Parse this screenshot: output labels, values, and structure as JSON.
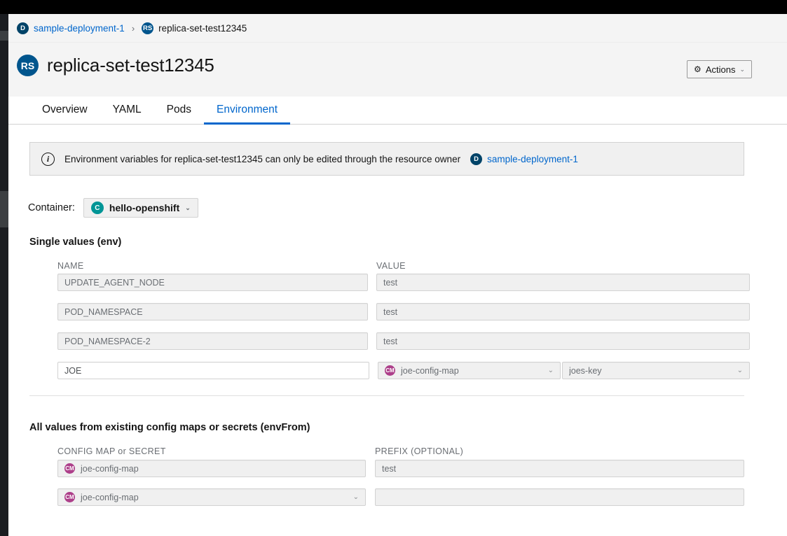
{
  "breadcrumb": {
    "items": [
      {
        "badge": "D",
        "badge_name": "deployment-badge-icon",
        "label": "sample-deployment-1",
        "link": true
      },
      {
        "badge": "RS",
        "badge_name": "replicaset-badge-icon",
        "label": "replica-set-test12345",
        "link": false
      }
    ],
    "separator": "›"
  },
  "header": {
    "badge": "RS",
    "title": "replica-set-test12345",
    "actions_label": "Actions",
    "actions_gear": "⚙",
    "actions_chevron": "⌄"
  },
  "tabs": [
    {
      "label": "Overview",
      "active": false
    },
    {
      "label": "YAML",
      "active": false
    },
    {
      "label": "Pods",
      "active": false
    },
    {
      "label": "Environment",
      "active": true
    }
  ],
  "alert": {
    "icon": "i",
    "message": "Environment variables for replica-set-test12345 can only be edited through the resource owner",
    "owner_badge": "D",
    "owner_label": "sample-deployment-1"
  },
  "container": {
    "label": "Container:",
    "badge": "C",
    "value": "hello-openshift",
    "chevron": "⌄"
  },
  "env_section": {
    "title": "Single values (env)",
    "columns": {
      "name": "NAME",
      "value": "VALUE"
    },
    "rows": [
      {
        "name": "UPDATE_AGENT_NODE",
        "value": "test",
        "type": "text"
      },
      {
        "name": "POD_NAMESPACE",
        "value": "test",
        "type": "text"
      },
      {
        "name": "POD_NAMESPACE-2",
        "value": "test",
        "type": "text"
      },
      {
        "name": "JOE",
        "type": "configmap-key",
        "resource_badge": "CM",
        "resource": "joe-config-map",
        "key": "joes-key",
        "chevron": "⌄"
      }
    ]
  },
  "envfrom_section": {
    "title": "All values from existing config maps or secrets (envFrom)",
    "columns": {
      "resource": "CONFIG MAP or SECRET",
      "prefix": "PREFIX (OPTIONAL)"
    },
    "rows": [
      {
        "badge": "CM",
        "resource": "joe-config-map",
        "prefix": "test",
        "chevron": ""
      },
      {
        "badge": "CM",
        "resource": "joe-config-map",
        "prefix": "",
        "chevron": "⌄"
      }
    ]
  },
  "colors": {
    "accent_link": "#0066cc",
    "badge_deployment": "#004368",
    "badge_replicaset": "#00558d",
    "badge_container": "#009596",
    "badge_configmap": "#ad3f8a",
    "masthead": "#000000",
    "page_bg": "#ffffff",
    "header_bg": "#f4f4f4"
  }
}
